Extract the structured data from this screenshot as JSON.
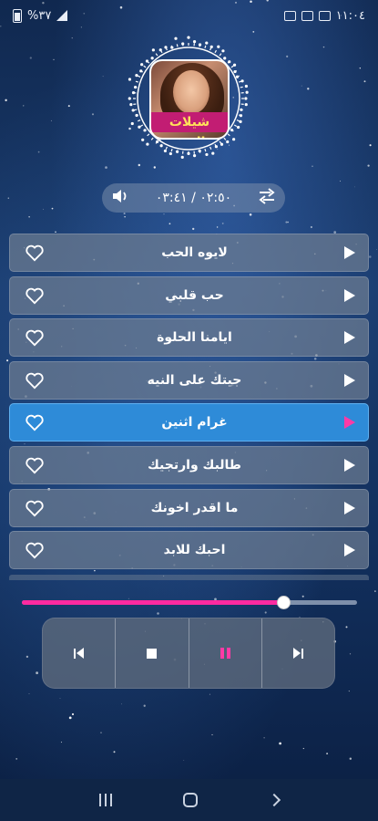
{
  "status_bar": {
    "time": "١١:٠٤",
    "battery": "%٣٧"
  },
  "album": {
    "label": "شيلات الحب"
  },
  "player": {
    "time_display": "٠٢:٥٠ / ٠٣:٤١",
    "progress_fraction": 0.78
  },
  "playlist": [
    {
      "title": "لايوه الحب",
      "active": false
    },
    {
      "title": "حب قلبي",
      "active": false
    },
    {
      "title": "ايامنا الحلوة",
      "active": false
    },
    {
      "title": "جيتك على النيه",
      "active": false
    },
    {
      "title": "غرام اثنين",
      "active": true
    },
    {
      "title": "طالبك وارتجيك",
      "active": false
    },
    {
      "title": "ما اقدر اخونك",
      "active": false
    },
    {
      "title": "احبك للابد",
      "active": false
    }
  ],
  "colors": {
    "accent": "#ff2aa0",
    "active_row": "#2e8bd8"
  },
  "icons": {
    "shuffle": "shuffle-icon",
    "volume": "volume-icon",
    "heart": "heart-outline-icon",
    "play": "play-icon",
    "prev": "previous-icon",
    "stop": "stop-icon",
    "pause": "pause-icon",
    "next": "next-icon"
  }
}
